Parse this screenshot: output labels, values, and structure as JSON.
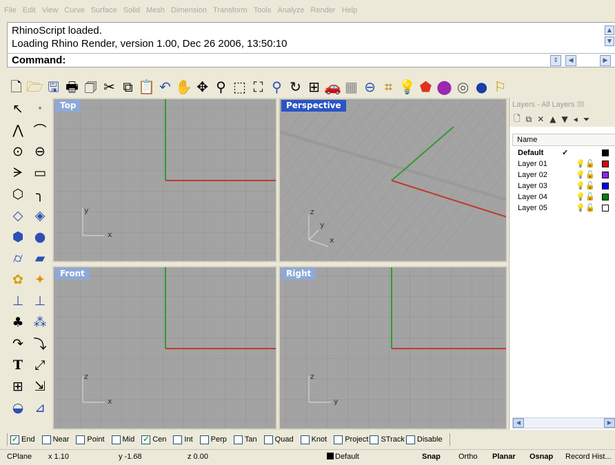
{
  "menu": [
    "File",
    "Edit",
    "View",
    "Curve",
    "Surface",
    "Solid",
    "Mesh",
    "Dimension",
    "Transform",
    "Tools",
    "Analyze",
    "Render",
    "Help"
  ],
  "command": {
    "history": [
      "RhinoScript loaded.",
      "Loading Rhino Render, version 1.00, Dec 26 2006, 13:50:10"
    ],
    "prompt": "Command:"
  },
  "main_toolbar_icons": [
    "new-icon",
    "open-icon",
    "save-icon",
    "print-icon",
    "import-icon",
    "cut-icon",
    "copy-icon",
    "paste-icon",
    "undo-icon",
    "pan-icon",
    "rotate-view-icon",
    "zoom-icon",
    "zoom-window-icon",
    "zoom-extents-icon",
    "zoom-selected-icon",
    "rotate-icon",
    "four-viewports-icon",
    "car-icon",
    "grid-icon",
    "osnap-icon",
    "cplane-icon",
    "light-icon",
    "shaded-icon",
    "color-icon",
    "render-icon",
    "sphere-icon",
    "properties-icon"
  ],
  "viewports": {
    "top": {
      "title": "Top",
      "axis_h": "x",
      "axis_v": "y"
    },
    "perspective": {
      "title": "Perspective",
      "axis_h": "x",
      "axis_v": "z",
      "axis_d": "y"
    },
    "front": {
      "title": "Front",
      "axis_h": "x",
      "axis_v": "z"
    },
    "right": {
      "title": "Right",
      "axis_h": "y",
      "axis_v": "z"
    }
  },
  "layers": {
    "title": "Layers - All Layers",
    "column_name": "Name",
    "rows": [
      {
        "name": "Default",
        "current": true,
        "check": "✓",
        "color": "#000000"
      },
      {
        "name": "Layer 01",
        "color": "#e00000"
      },
      {
        "name": "Layer 02",
        "color": "#8a2be2"
      },
      {
        "name": "Layer 03",
        "color": "#0000ff"
      },
      {
        "name": "Layer 04",
        "color": "#008000"
      },
      {
        "name": "Layer 05",
        "color": "#ffffff"
      }
    ]
  },
  "osnap": [
    {
      "label": "End",
      "checked": true
    },
    {
      "label": "Near",
      "checked": false
    },
    {
      "label": "Point",
      "checked": false
    },
    {
      "label": "Mid",
      "checked": false
    },
    {
      "label": "Cen",
      "checked": true
    },
    {
      "label": "Int",
      "checked": false
    },
    {
      "label": "Perp",
      "checked": false
    },
    {
      "label": "Tan",
      "checked": false
    },
    {
      "label": "Quad",
      "checked": false
    },
    {
      "label": "Knot",
      "checked": false
    },
    {
      "label": "Project",
      "checked": false
    },
    {
      "label": "STrack",
      "checked": false
    },
    {
      "label": "Disable",
      "checked": false
    }
  ],
  "status": {
    "cplane": "CPlane",
    "x": "x 1.10",
    "y": "y -1.68",
    "z": "z 0.00",
    "layer": "Default",
    "snap": "Snap",
    "ortho": "Ortho",
    "planar": "Planar",
    "osnap": "Osnap",
    "record": "Record Hist..."
  }
}
